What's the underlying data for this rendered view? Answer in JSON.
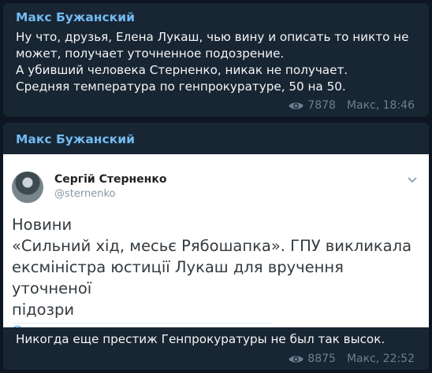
{
  "messages": [
    {
      "author": "Макс Бужанский",
      "lines": [
        "Ну что, друзья, Елена Лукаш, чью вину и описать то никто не",
        "может, получает уточненное подозрение.",
        "А убивший человека Стерненко, никак не получает.",
        "Средняя температура по генпрокуратуре, 50 на 50."
      ],
      "views": "7878",
      "signature": "Макс, 18:46"
    },
    {
      "author": "Макс Бужанский",
      "tweet": {
        "name": "Сергій Стерненко",
        "handle": "@sternenko",
        "body_lines": [
          "Новини",
          "«Сильний хід, месьє Рябошапка». ГПУ викликала",
          "ексміністра юстиції Лукаш для вручення уточненої",
          "підозри"
        ]
      },
      "caption": "Никогда еще престиж Генпрокуратуры не был так высок.",
      "views": "8875",
      "signature": "Макс, 22:52"
    }
  ],
  "colors": {
    "background": "#0e1621",
    "bubble": "#182533",
    "author": "#71baf0",
    "meta": "#6d7f8f"
  },
  "icons": [
    "eye-icon",
    "chevron-down-icon"
  ]
}
